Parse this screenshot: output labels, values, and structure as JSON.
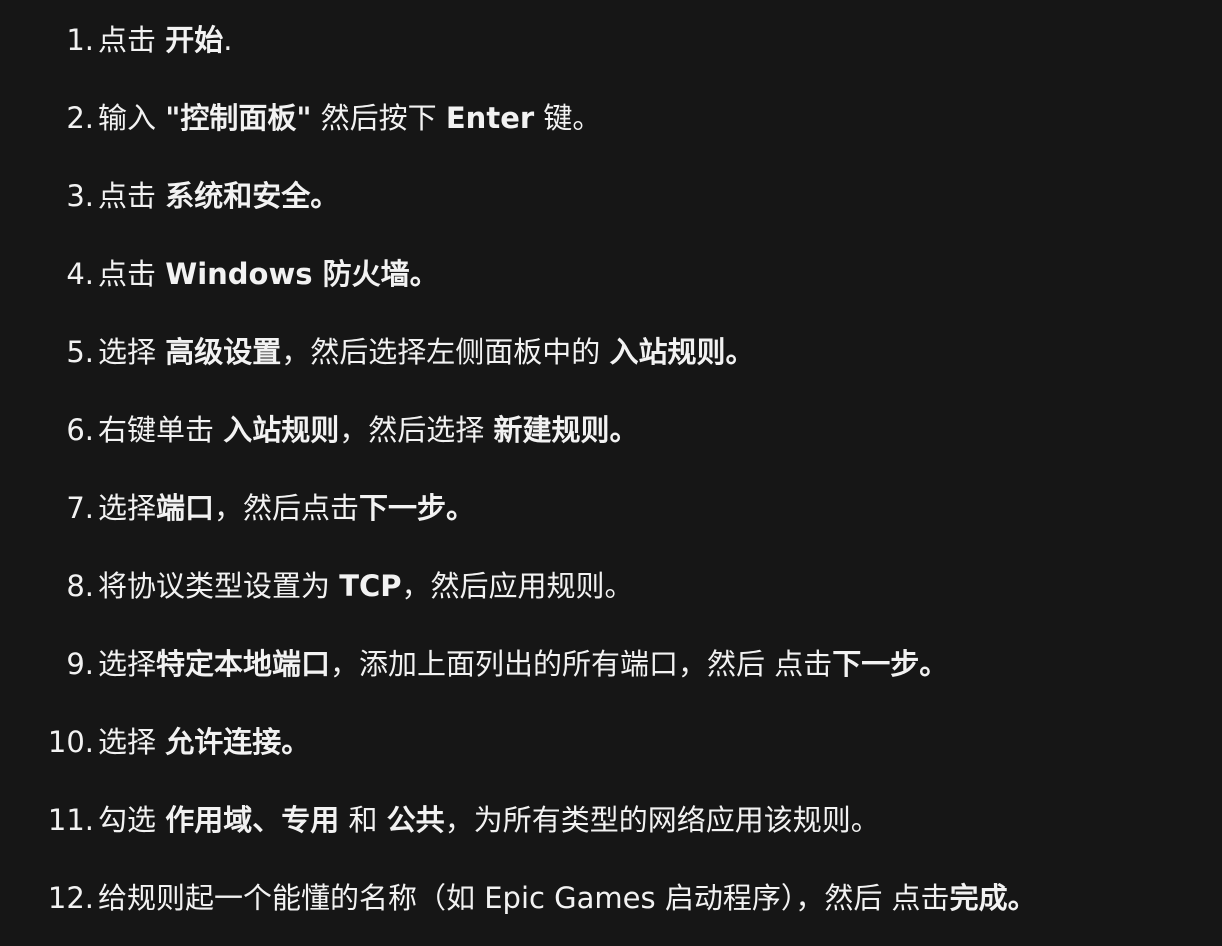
{
  "steps": [
    {
      "number": "1.",
      "parts": [
        {
          "text": "点击 ",
          "bold": false
        },
        {
          "text": "开始",
          "bold": true
        },
        {
          "text": ".",
          "bold": false
        }
      ]
    },
    {
      "number": "2.",
      "parts": [
        {
          "text": "输入 ",
          "bold": false
        },
        {
          "text": "\"控制面板\"",
          "bold": true
        },
        {
          "text": " 然后按下 ",
          "bold": false
        },
        {
          "text": "Enter",
          "bold": true
        },
        {
          "text": " 键。",
          "bold": false
        }
      ]
    },
    {
      "number": "3.",
      "parts": [
        {
          "text": "点击 ",
          "bold": false
        },
        {
          "text": "系统和安全。",
          "bold": true
        }
      ]
    },
    {
      "number": "4.",
      "parts": [
        {
          "text": "点击 ",
          "bold": false
        },
        {
          "text": "Windows 防火墙。",
          "bold": true
        }
      ]
    },
    {
      "number": "5.",
      "parts": [
        {
          "text": "选择 ",
          "bold": false
        },
        {
          "text": "高级设置",
          "bold": true
        },
        {
          "text": "，然后选择左侧面板中的 ",
          "bold": false
        },
        {
          "text": "入站规则。",
          "bold": true
        }
      ]
    },
    {
      "number": "6.",
      "parts": [
        {
          "text": "右键单击 ",
          "bold": false
        },
        {
          "text": "入站规则",
          "bold": true
        },
        {
          "text": "，然后选择 ",
          "bold": false
        },
        {
          "text": "新建规则。",
          "bold": true
        }
      ]
    },
    {
      "number": "7.",
      "parts": [
        {
          "text": "选择",
          "bold": false
        },
        {
          "text": "端口",
          "bold": true
        },
        {
          "text": "，然后点击",
          "bold": false
        },
        {
          "text": "下一步。",
          "bold": true
        }
      ]
    },
    {
      "number": "8.",
      "parts": [
        {
          "text": "将协议类型设置为 ",
          "bold": false
        },
        {
          "text": "TCP",
          "bold": true
        },
        {
          "text": "，然后应用规则。",
          "bold": false
        }
      ]
    },
    {
      "number": "9.",
      "parts": [
        {
          "text": "选择",
          "bold": false
        },
        {
          "text": "特定本地端口",
          "bold": true
        },
        {
          "text": "，添加上面列出的所有端口，然后 点击",
          "bold": false
        },
        {
          "text": "下一步。",
          "bold": true
        }
      ]
    },
    {
      "number": "10.",
      "parts": [
        {
          "text": "选择 ",
          "bold": false
        },
        {
          "text": "允许连接。",
          "bold": true
        }
      ]
    },
    {
      "number": "11.",
      "parts": [
        {
          "text": "勾选 ",
          "bold": false
        },
        {
          "text": "作用域、专用",
          "bold": true
        },
        {
          "text": " 和 ",
          "bold": false
        },
        {
          "text": "公共",
          "bold": true
        },
        {
          "text": "，为所有类型的网络应用该规则。",
          "bold": false
        }
      ]
    },
    {
      "number": "12.",
      "parts": [
        {
          "text": "给规则起一个能懂的名称（如 Epic Games 启动程序），然后 点击",
          "bold": false
        },
        {
          "text": "完成。",
          "bold": true
        }
      ]
    }
  ]
}
